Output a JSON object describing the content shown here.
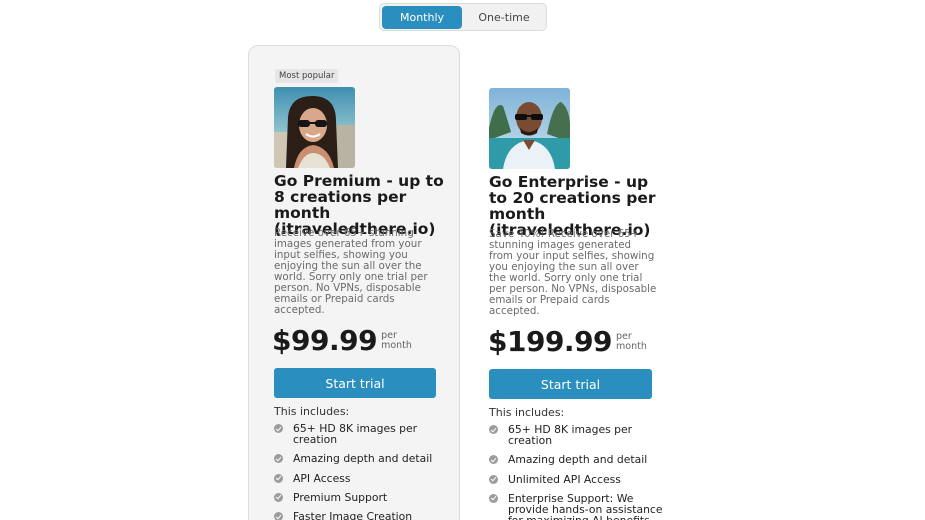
{
  "billing_toggle": {
    "monthly_label": "Monthly",
    "onetime_label": "One-time",
    "selected": "Monthly"
  },
  "plans": [
    {
      "badge": "Most popular",
      "title": "Go Premium - up to 8 creations per month (itraveledthere.io)",
      "description": "Receive over 65+ stunning images generated from your input selfies, showing you enjoying the sun all over the world. Sorry only one trial per person. No VPNs, disposable emails or Prepaid cards accepted.",
      "price": "$99.99",
      "period": "per month",
      "cta": "Start trial",
      "includes_label": "This includes:",
      "features": [
        "65+ HD 8K images per creation",
        "Amazing depth and detail",
        "API Access",
        "Premium Support",
        "Faster Image Creation"
      ]
    },
    {
      "title": "Go Enterprise - up to 20 creations per month (itraveledthere.io)",
      "description": "Save 40%! Receive over 65+ stunning images generated from your input selfies, showing you enjoying the sun all over the world. Sorry only one trial per person. No VPNs, disposable emails or Prepaid cards accepted.",
      "price": "$199.99",
      "period": "per month",
      "cta": "Start trial",
      "includes_label": "This includes:",
      "features": [
        "65+ HD 8K images per creation",
        "Amazing depth and detail",
        "Unlimited API Access",
        "Enterprise Support: We provide hands-on assistance for maximizing AI benefits."
      ]
    }
  ],
  "colors": {
    "accent": "#2a8fbe",
    "card_bg": "#f4f4f4",
    "check": "#9c9c9c"
  }
}
